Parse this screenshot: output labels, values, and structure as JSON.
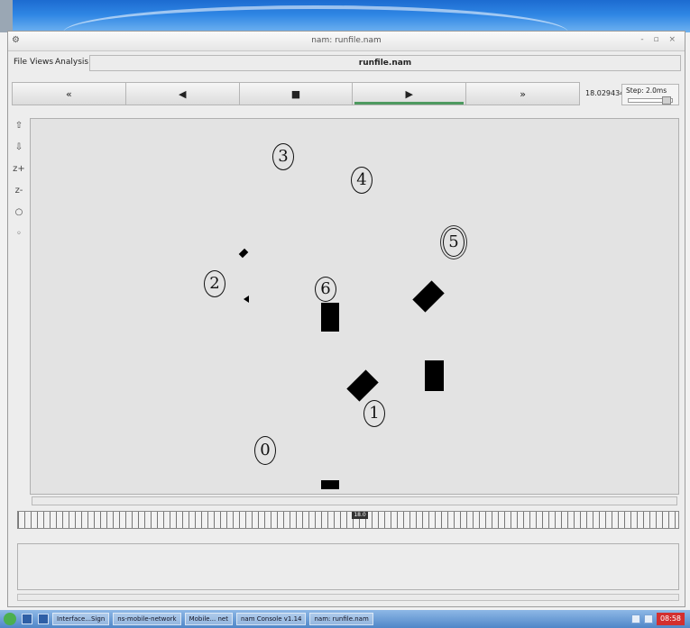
{
  "window": {
    "title": "nam: runfile.nam",
    "controls": "- ▫ ×"
  },
  "menu": {
    "items": [
      "File",
      "Views",
      "Analysis"
    ],
    "filename": "runfile.nam"
  },
  "playback": {
    "buttons": [
      {
        "name": "rewind",
        "label": "«"
      },
      {
        "name": "step-back",
        "label": "◀"
      },
      {
        "name": "stop",
        "label": "■"
      },
      {
        "name": "play",
        "label": "▶"
      },
      {
        "name": "fast-forward",
        "label": "»"
      }
    ],
    "time": "18.029434",
    "step_label": "Step: 2.0ms"
  },
  "tools": [
    "⇧",
    "⇩",
    "z+",
    "z-",
    "○",
    "◦"
  ],
  "nodes": [
    {
      "id": "3",
      "label": "3"
    },
    {
      "id": "4",
      "label": "4"
    },
    {
      "id": "5",
      "label": "5"
    },
    {
      "id": "2",
      "label": "2"
    },
    {
      "id": "6",
      "label": "6"
    },
    {
      "id": "1",
      "label": "1"
    },
    {
      "id": "0",
      "label": "0"
    }
  ],
  "timeline": {
    "marker_label": "18.0"
  },
  "taskbar": {
    "tasks": [
      "Interface...Sign",
      "ns-mobile-network",
      "Mobile... net",
      "nam Console v1.14",
      "nam: runfile.nam"
    ],
    "clock": "08:58"
  }
}
